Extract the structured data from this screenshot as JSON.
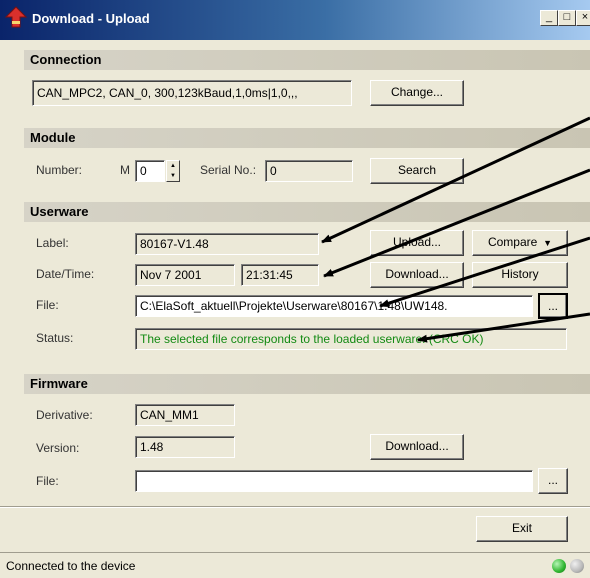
{
  "window": {
    "title": "Download - Upload",
    "buttons": {
      "minimize": "_",
      "maximize": "□",
      "close": "×"
    }
  },
  "connection": {
    "header": "Connection",
    "value": "CAN_MPC2, CAN_0, 300,123kBaud,1,0ms|1,0,,,",
    "change_button": "Change..."
  },
  "module": {
    "header": "Module",
    "number_label": "Number:",
    "number_prefix": "M",
    "number_value": "0",
    "serial_label": "Serial No.:",
    "serial_value": "0",
    "search_button": "Search"
  },
  "userware": {
    "header": "Userware",
    "label_label": "Label:",
    "label_value": "80167-V1.48",
    "datetime_label": "Date/Time:",
    "date_value": "Nov  7 2001",
    "time_value": "21:31:45",
    "file_label": "File:",
    "file_value": "C:\\ElaSoft_aktuell\\Projekte\\Userware\\80167\\1.48\\UW148.",
    "browse_button": "...",
    "status_label": "Status:",
    "status_value": "The selected file corresponds to the loaded userware. (CRC OK)",
    "upload_button": "Upload...",
    "compare_button": "Compare",
    "download_button": "Download...",
    "history_button": "History"
  },
  "firmware": {
    "header": "Firmware",
    "derivative_label": "Derivative:",
    "derivative_value": "CAN_MM1",
    "version_label": "Version:",
    "version_value": "1.48",
    "file_label": "File:",
    "file_value": "",
    "download_button": "Download...",
    "browse_button": "..."
  },
  "footer": {
    "exit_button": "Exit",
    "status_text": "Connected to the device"
  },
  "colors": {
    "status_green": "#138a13",
    "led_on": "#2fb52f",
    "led_off": "#b8b8b8"
  }
}
